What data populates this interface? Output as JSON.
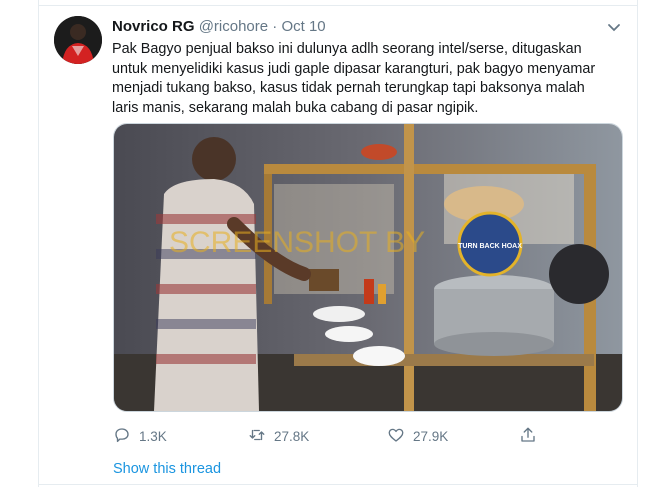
{
  "tweet": {
    "author_name": "Novrico RG",
    "handle": "@ricohore",
    "separator": "·",
    "date": "Oct 10",
    "text_lines": [
      "Pak Bagyo penjual bakso ini dulunya adlh seorang intel/serse, ditugaskan",
      "untuk menyelidiki kasus judi gaple dipasar karangturi, pak bagyo menyamar",
      "menjadi tukang bakso, kasus tidak pernah terungkap tapi baksonya malah",
      "laris manis, sekarang malah buka cabang di pasar ngipik."
    ],
    "media": {
      "watermark_text": "SCREENSHOT BY",
      "badge_text": "TURN BACK HOAX"
    },
    "actions": {
      "reply_count": "1.3K",
      "retweet_count": "27.8K",
      "like_count": "27.9K"
    },
    "show_thread_label": "Show this thread"
  },
  "icons": {
    "caret": "chevron-down-icon",
    "reply": "reply-icon",
    "retweet": "retweet-icon",
    "like": "heart-icon",
    "share": "share-icon"
  },
  "colors": {
    "primary_text": "#14171a",
    "secondary_text": "#657786",
    "link": "#1b95e0",
    "border": "#e6ecf0"
  }
}
